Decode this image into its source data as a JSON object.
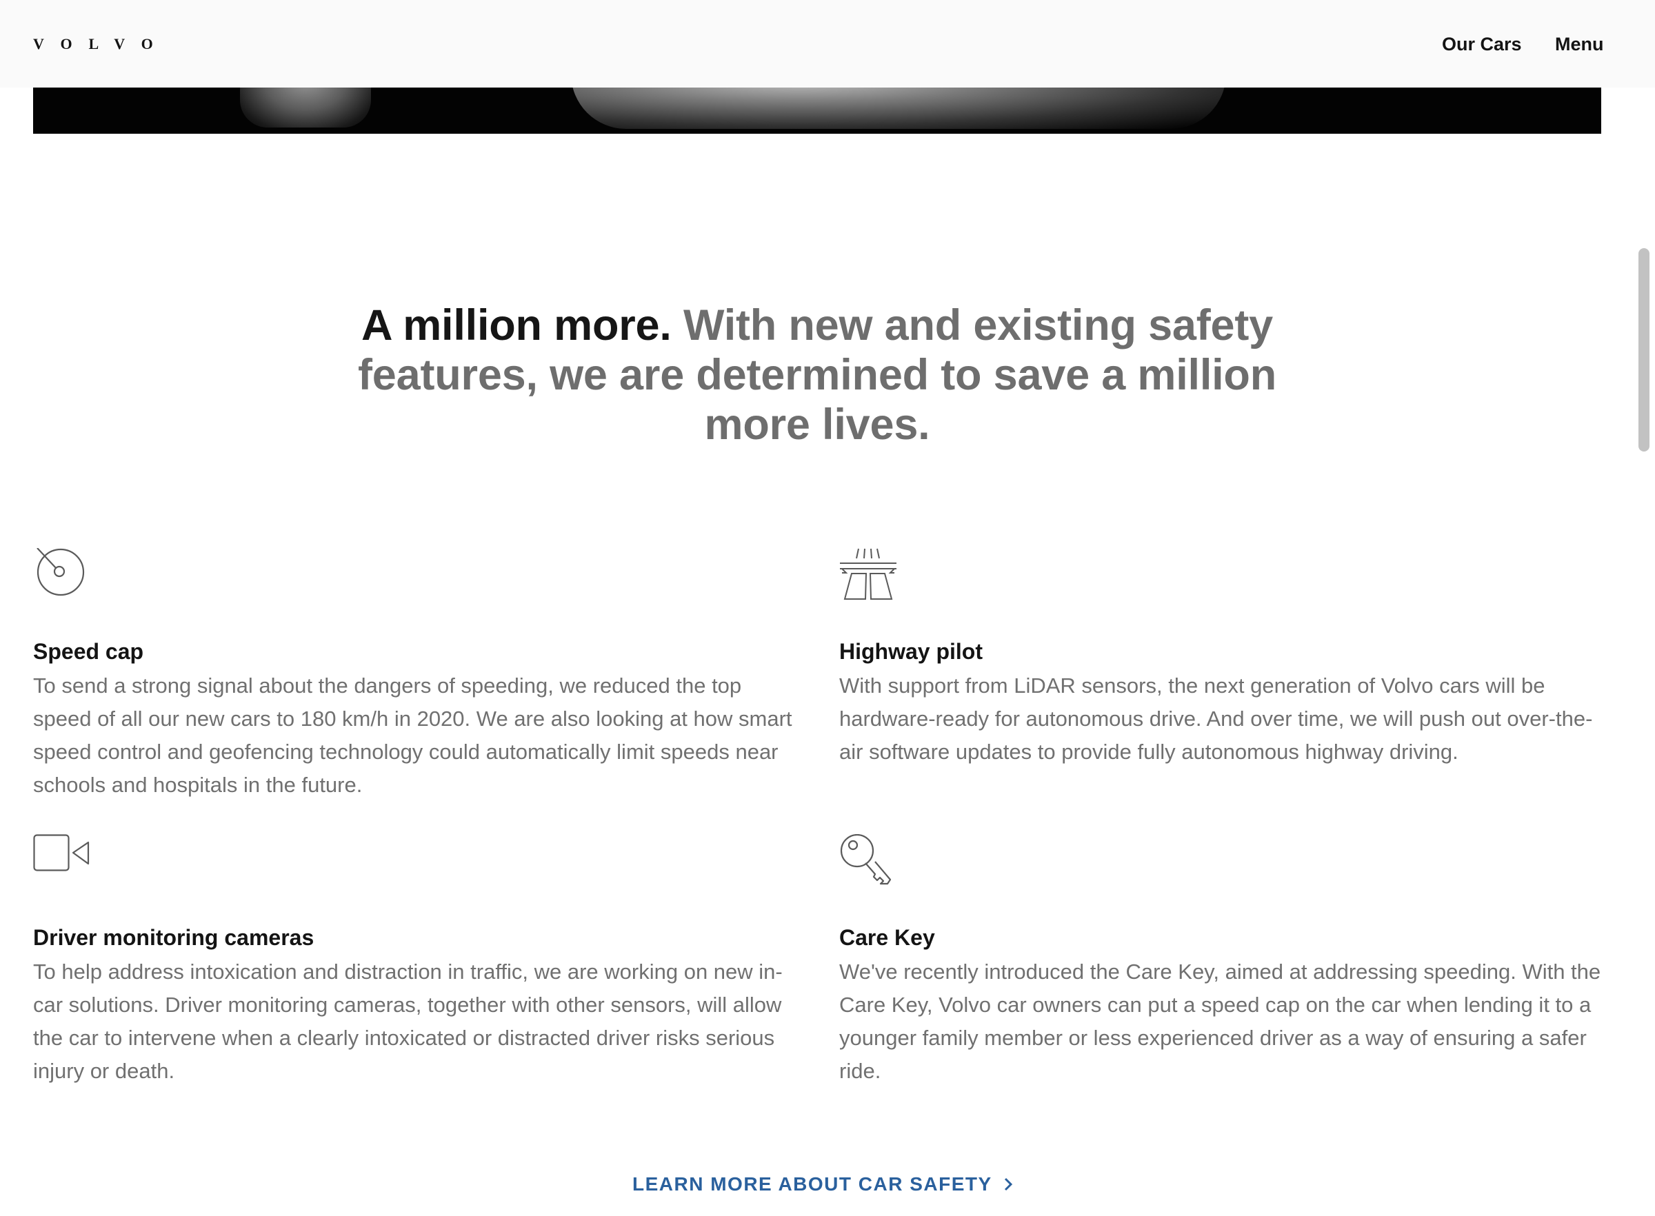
{
  "header": {
    "logo_text": "VOLVO",
    "nav": {
      "our_cars": "Our Cars",
      "menu": "Menu"
    }
  },
  "headline": {
    "lead": "A million more.",
    "rest": "With new and existing safety features, we are determined to save a million more lives."
  },
  "features": [
    {
      "icon": "speedometer-icon",
      "title": "Speed cap",
      "body": "To send a strong signal about the dangers of speeding, we reduced the top speed of all our new cars to 180 km/h in 2020. We are also looking at how smart speed control and geofencing technology could automatically limit speeds near schools and hospitals in the future."
    },
    {
      "icon": "highway-icon",
      "title": "Highway pilot",
      "body": "With support from LiDAR sensors, the next generation of Volvo cars will be hardware-ready for autonomous drive. And over time, we will push out over-the-air software updates to provide fully autonomous highway driving."
    },
    {
      "icon": "video-camera-icon",
      "title": "Driver monitoring cameras",
      "body": "To help address intoxication and distraction in traffic, we are working on new in-car solutions. Driver monitoring cameras, together with other sensors, will allow the car to intervene when a clearly intoxicated or distracted driver risks serious injury or death."
    },
    {
      "icon": "key-icon",
      "title": "Care Key",
      "body": "We've recently introduced the Care Key, aimed at addressing speeding. With the Care Key, Volvo car owners can put a speed cap on the car when lending it to a younger family member or less experienced driver as a way of ensuring a safer ride."
    }
  ],
  "cta": {
    "label": "LEARN MORE ABOUT CAR SAFETY",
    "icon": "chevron-right-icon"
  },
  "colors": {
    "header_bg": "#fafafa",
    "text_dark": "#141414",
    "text_muted": "#707070",
    "headline_muted": "#6e6e6e",
    "link_blue": "#2a609d"
  }
}
